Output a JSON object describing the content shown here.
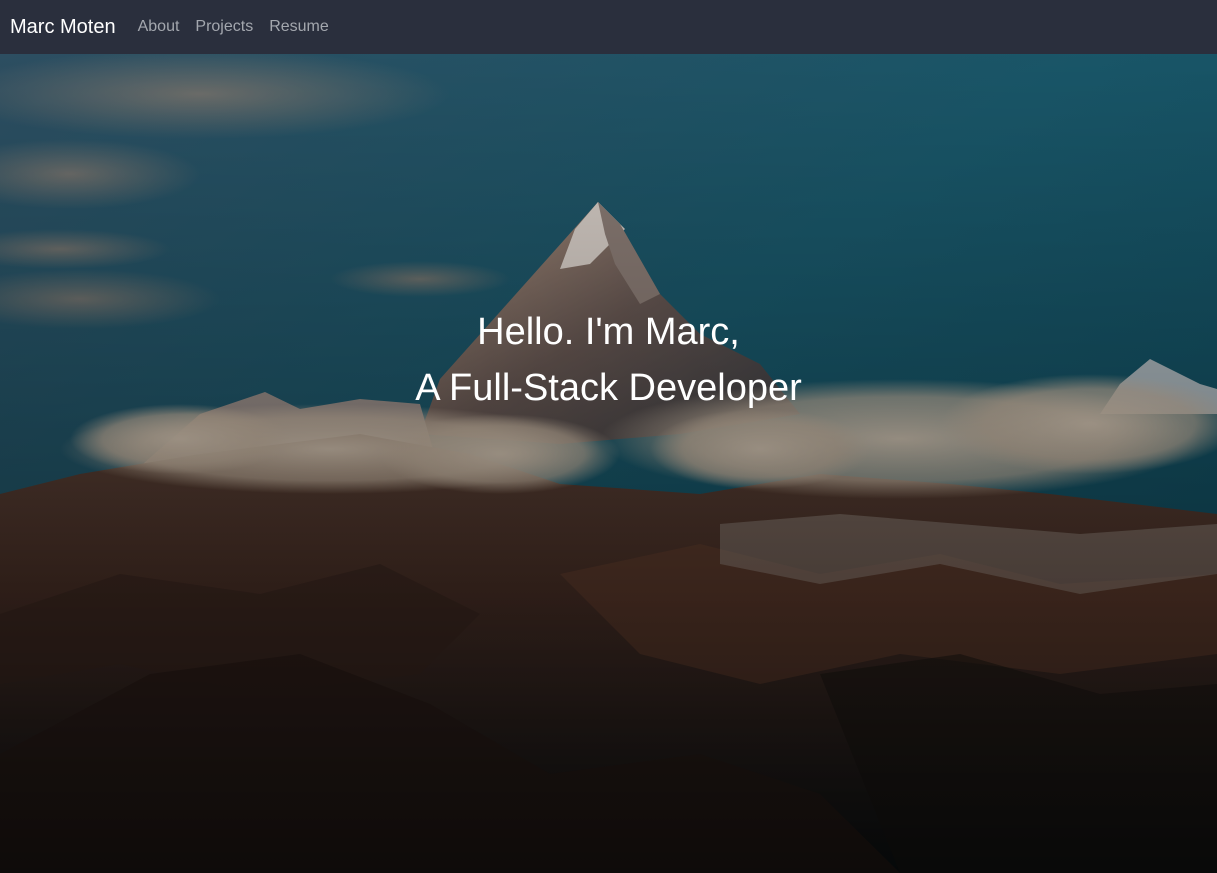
{
  "navbar": {
    "brand": "Marc Moten",
    "links": [
      {
        "label": "About"
      },
      {
        "label": "Projects"
      },
      {
        "label": "Resume"
      }
    ]
  },
  "hero": {
    "line1": "Hello. I'm Marc,",
    "line2": "A Full-Stack Developer",
    "background": "mountain-peak-with-clouds-photo"
  },
  "colors": {
    "navbar_bg": "#2a2f3d",
    "brand_text": "#ffffff",
    "nav_link_text": "#a3a7ae",
    "hero_text": "#ffffff"
  }
}
